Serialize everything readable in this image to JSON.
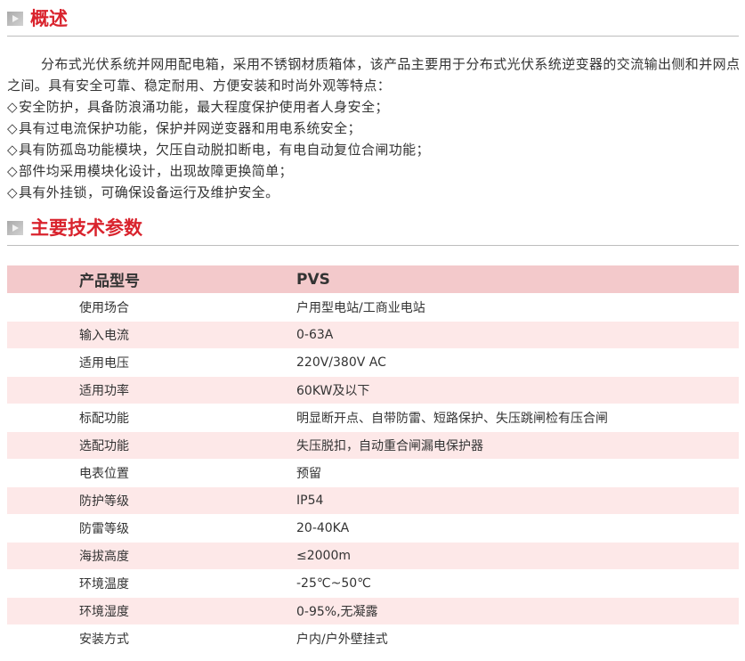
{
  "sections": {
    "overview_title": "概述",
    "params_title": "主要技术参数"
  },
  "overview": {
    "paragraph": "分布式光伏系统并网用配电箱，采用不锈钢材质箱体，该产品主要用于分布式光伏系统逆变器的交流输出侧和并网点之间。具有安全可靠、稳定耐用、方便安装和时尚外观等特点：",
    "bullets": [
      "安全防护，具备防浪涌功能，最大程度保护使用者人身安全；",
      "具有过电流保护功能，保护并网逆变器和用电系统安全；",
      "具有防孤岛功能模块，欠压自动脱扣断电，有电自动复位合闸功能；",
      "部件均采用模块化设计，出现故障更换简单；",
      "具有外挂锁，可确保设备运行及维护安全。"
    ]
  },
  "table": {
    "header": [
      "产品型号",
      "PVS"
    ],
    "rows": [
      [
        "使用场合",
        "户用型电站/工商业电站"
      ],
      [
        "输入电流",
        "0-63A"
      ],
      [
        "适用电压",
        "220V/380V AC"
      ],
      [
        "适用功率",
        "60KW及以下"
      ],
      [
        "标配功能",
        "明显断开点、自带防雷、短路保护、失压跳闸检有压合闸"
      ],
      [
        "选配功能",
        "失压脱扣，自动重合闸漏电保护器"
      ],
      [
        "电表位置",
        "预留"
      ],
      [
        "防护等级",
        "IP54"
      ],
      [
        "防雷等级",
        "20-40KA"
      ],
      [
        "海拔高度",
        "≤2000m"
      ],
      [
        "环境温度",
        "-25℃~50℃"
      ],
      [
        "环境湿度",
        "0-95%,无凝露"
      ],
      [
        "安装方式",
        "户内/户外壁挂式"
      ]
    ]
  },
  "icons": {
    "section_marker": "section-arrow-icon",
    "bullet": "diamond-bullet-icon"
  },
  "colors": {
    "title_red": "#d9232d",
    "header_row": "#f3c9cb",
    "stripe_row": "#fde8e8"
  }
}
